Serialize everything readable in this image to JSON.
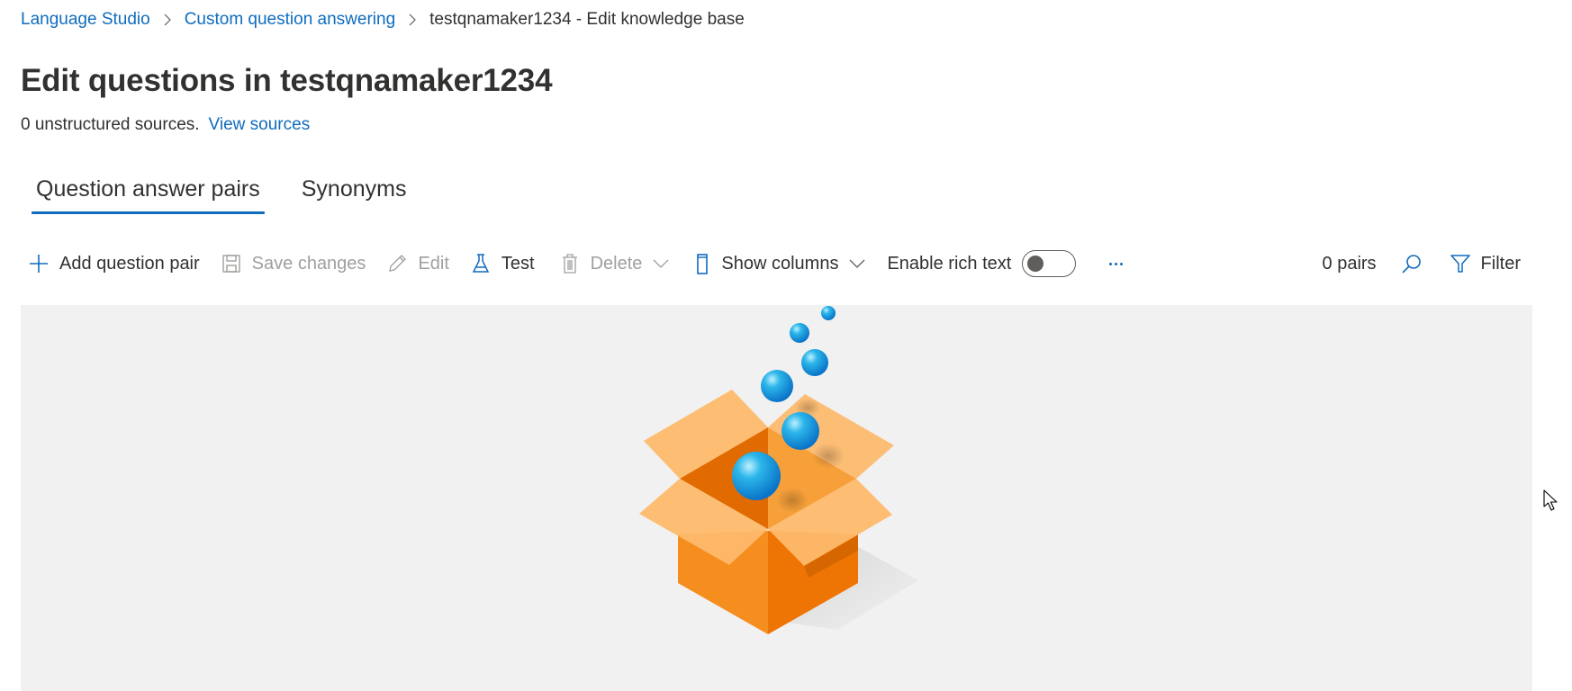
{
  "breadcrumb": {
    "items": [
      {
        "label": "Language Studio",
        "link": true
      },
      {
        "label": "Custom question answering",
        "link": true
      },
      {
        "label": "testqnamaker1234 - Edit knowledge base",
        "link": false
      }
    ],
    "separator_icon": "chevron-right-icon"
  },
  "header": {
    "title": "Edit questions in testqnamaker1234",
    "sources_text": "0 unstructured sources.",
    "view_sources_label": "View sources"
  },
  "tabs": [
    {
      "label": "Question answer pairs",
      "active": true
    },
    {
      "label": "Synonyms",
      "active": false
    }
  ],
  "toolbar": {
    "add_label": "Add question pair",
    "add_icon": "plus-icon",
    "save_label": "Save changes",
    "save_icon": "save-icon",
    "save_disabled": true,
    "edit_label": "Edit",
    "edit_icon": "pencil-icon",
    "edit_disabled": true,
    "test_label": "Test",
    "test_icon": "flask-icon",
    "delete_label": "Delete",
    "delete_icon": "trash-icon",
    "delete_disabled": true,
    "show_columns_label": "Show columns",
    "show_columns_icon": "column-icon",
    "rich_text_label": "Enable rich text",
    "rich_text_enabled": false,
    "more_icon": "more-icon",
    "pairs_count": "0 pairs",
    "search_icon": "search-icon",
    "filter_label": "Filter",
    "filter_icon": "filter-icon"
  },
  "empty_state": {
    "illustration": "open-box-with-bubbles"
  },
  "colors": {
    "accent": "#0f6cbd",
    "text": "#323130",
    "disabled_text": "#a19f9d",
    "panel_background": "#f1f1f1",
    "box_orange": "#f7901e",
    "bubble_blue": "#1aa3e0"
  }
}
